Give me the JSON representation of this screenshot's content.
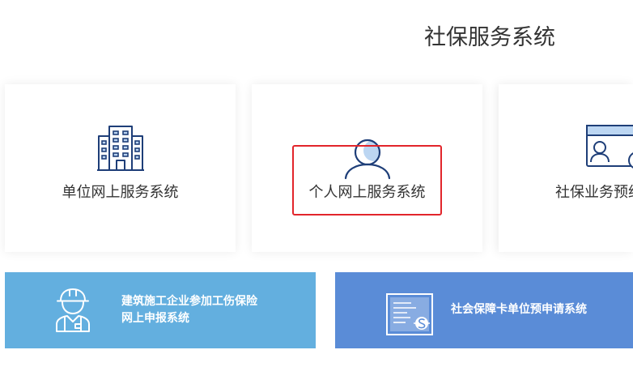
{
  "page": {
    "title": "社保服务系统"
  },
  "cards": [
    {
      "label": "单位网上服务系统",
      "icon": "building-icon"
    },
    {
      "label": "个人网上服务系统",
      "icon": "person-icon"
    },
    {
      "label": "社保业务预约",
      "icon": "id-card-icon"
    }
  ],
  "banners": [
    {
      "lines": [
        "建筑施工企业参加工伤保险",
        "网上申报系统"
      ],
      "icon": "construction-worker-icon",
      "color": "#63AFDF"
    },
    {
      "lines": [
        "社会保障卡单位预申请系统"
      ],
      "icon": "social-security-card-icon",
      "color": "#5A8CD7"
    }
  ],
  "colors": {
    "icon_stroke": "#1E3E78",
    "icon_accent": "#BCD6F2",
    "text": "#333333",
    "highlight": "#E2252B"
  }
}
